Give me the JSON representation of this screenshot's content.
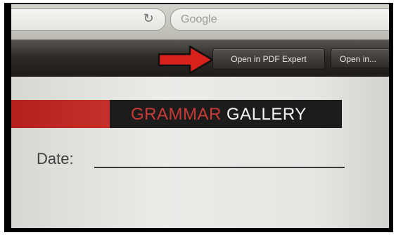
{
  "browser": {
    "search_placeholder": "Google",
    "reload_icon": "reload-icon"
  },
  "toolbar": {
    "pdf_expert_label": "Open in PDF Expert",
    "open_in_label": "Open in..."
  },
  "annotation": {
    "arrow_color": "#d8211a",
    "arrow_icon": "right-arrow-icon"
  },
  "document": {
    "banner_red_word": "GRAMMAR",
    "banner_white_word": "GALLERY",
    "date_label": "Date:",
    "colors": {
      "banner_red": "#c6302a",
      "banner_black": "#1c1c1c"
    }
  }
}
